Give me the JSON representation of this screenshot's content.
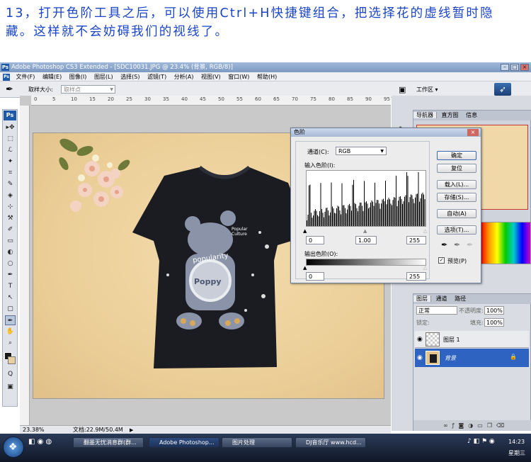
{
  "caption": {
    "line1": "13，打开色阶工具之后，可以使用Ctrl+H快捷键组合，把选择花的虚线暂时隐",
    "line2": "藏。这样就不会妨碍我们的视线了。"
  },
  "app": {
    "icon_label": "Ps",
    "title": "Adobe Photoshop CS3 Extended - [SDC10031.JPG @ 23.4% (背景, RGB/8)]",
    "menus": [
      "文件(F)",
      "编辑(E)",
      "图像(I)",
      "图层(L)",
      "选择(S)",
      "滤镜(T)",
      "分析(A)",
      "视图(V)",
      "窗口(W)",
      "帮助(H)"
    ],
    "options": {
      "sample_label": "取样大小:",
      "sample_value": "取样点",
      "workspace_label": "工作区 ▾"
    },
    "ruler_marks": [
      "0",
      "5",
      "10",
      "15",
      "20",
      "25",
      "30",
      "35",
      "40",
      "45",
      "50",
      "55",
      "60",
      "65",
      "70",
      "75",
      "80",
      "85",
      "90",
      "95"
    ],
    "tools": [
      "▸✥",
      "⬚",
      "ℒ",
      "✦",
      "⌗",
      "✎",
      "◈",
      "⊹",
      "⚒",
      "✐",
      "▭",
      "◐",
      "○",
      "✒",
      "T",
      "↖",
      "▢",
      "☞",
      "⌕",
      "✋",
      "Q"
    ],
    "status": {
      "zoom": "23.38%",
      "doc": "文档:22.9M/50.4M"
    }
  },
  "dialog": {
    "title": "色阶",
    "channel_label": "通道(C):",
    "channel_value": "RGB",
    "input_label": "输入色阶(I):",
    "input_values": [
      "0",
      "1.00",
      "255"
    ],
    "output_label": "输出色阶(O):",
    "output_values": [
      "0",
      "255"
    ],
    "buttons": [
      "确定",
      "复位",
      "载入(L)...",
      "存储(S)...",
      "自动(A)",
      "选项(T)..."
    ],
    "preview_label": "预览(P)",
    "preview_checked": true
  },
  "panels": {
    "nav_tabs": [
      "导航器",
      "直方图",
      "信息"
    ],
    "layers_tabs": [
      "图层",
      "通道",
      "路径"
    ],
    "blend_mode": "正常",
    "opacity_label": "不透明度:",
    "opacity_value": "100%",
    "lock_label": "锁定:",
    "fill_label": "填充:",
    "fill_value": "100%",
    "layers": [
      {
        "name": "图层 1",
        "selected": false
      },
      {
        "name": "背景",
        "selected": true
      }
    ]
  },
  "shirt_text": {
    "line1": "popularity",
    "line2": "Poppy",
    "tag": "Popular Culture"
  },
  "taskbar": {
    "items": [
      "翻墨无忧消息群(群...",
      "Adobe Photoshop...",
      "图片处理",
      "DJ音乐厅 www.hcd..."
    ],
    "time": "14:23",
    "day": "星期三"
  },
  "colors": {
    "caption_blue": "#1b45c8",
    "ps_blue": "#1e5aa8",
    "layer_selected": "#2f63c1"
  }
}
